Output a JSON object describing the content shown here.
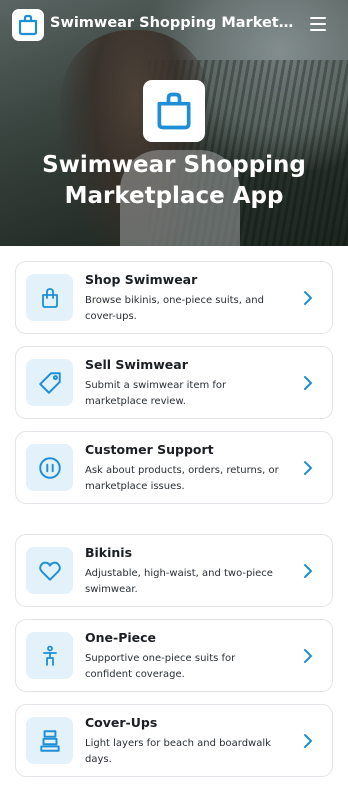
{
  "header": {
    "app_title": "Swimwear Shopping Marketplace App",
    "menu_icon": "hamburger-menu-icon",
    "logo_icon": "shopping-bag-icon"
  },
  "hero": {
    "title": "Swimwear Shopping Marketplace App",
    "icon": "shopping-bag-icon"
  },
  "colors": {
    "accent": "#1e8fd6",
    "icon_bg": "#e3f1fb",
    "card_border": "#e1e4e8"
  },
  "actions": [
    {
      "title": "Shop Swimwear",
      "description": "Browse bikinis, one-piece suits, and cover-ups.",
      "icon": "shopping-bag-icon"
    },
    {
      "title": "Sell Swimwear",
      "description": "Submit a swimwear item for marketplace review.",
      "icon": "price-tag-icon"
    },
    {
      "title": "Customer Support",
      "description": "Ask about products, orders, returns, or marketplace issues.",
      "icon": "support-chat-icon"
    }
  ],
  "categories": [
    {
      "title": "Bikinis",
      "description": "Adjustable, high-waist, and two-piece swimwear.",
      "icon": "heart-icon"
    },
    {
      "title": "One-Piece",
      "description": "Supportive one-piece suits for confident coverage.",
      "icon": "person-icon"
    },
    {
      "title": "Cover-Ups",
      "description": "Light layers for beach and boardwalk days.",
      "icon": "layers-icon"
    }
  ]
}
